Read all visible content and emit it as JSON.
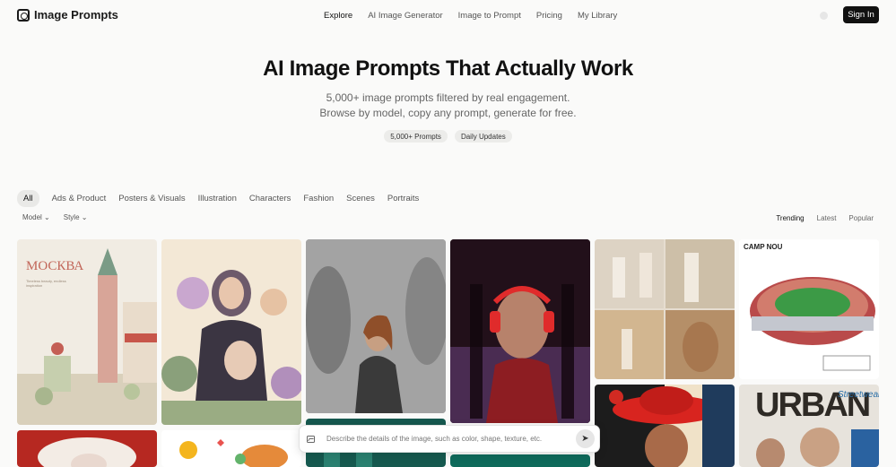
{
  "brand": {
    "name": "Image Prompts"
  },
  "nav": {
    "items": [
      "Explore",
      "AI Image Generator",
      "Image to Prompt",
      "Pricing",
      "My Library"
    ],
    "active": "Explore",
    "signin_label": "Sign In"
  },
  "hero": {
    "title": "AI Image Prompts That Actually Work",
    "subtitle_line1": "5,000+ image prompts filtered by real engagement.",
    "subtitle_line2": "Browse by model, copy any prompt, generate for free.",
    "badge_prompts": "5,000+ Prompts",
    "badge_updates": "Daily Updates"
  },
  "categories": [
    "All",
    "Ads & Product",
    "Posters & Visuals",
    "Illustration",
    "Characters",
    "Fashion",
    "Scenes",
    "Portraits"
  ],
  "active_category": "All",
  "filters": {
    "model": "Model",
    "style": "Style"
  },
  "sort": {
    "options": [
      "Trending",
      "Latest",
      "Popular"
    ],
    "active": "Trending"
  },
  "gallery": {
    "moskva_title": "МОСКВА",
    "moskva_caption": "Timeless beauty, endless inspiration",
    "stadium_title": "CAMP NOU",
    "urban_title": "URBAN",
    "urban_sub": "Streetwear"
  },
  "prompt_bar": {
    "placeholder": "Describe the details of the image, such as color, shape, texture, etc."
  },
  "colors": {
    "primary": "#111111",
    "page_bg": "#fafaf9",
    "chip_bg": "#ececea"
  }
}
